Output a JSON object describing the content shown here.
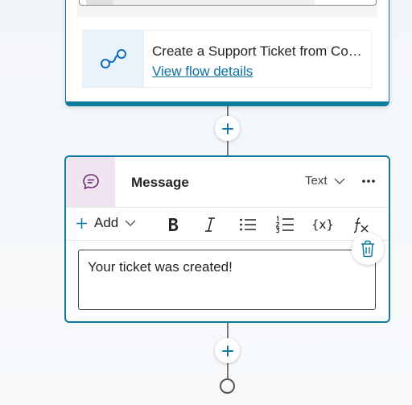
{
  "flow_card": {
    "title": "Create a Support Ticket from Co…",
    "link": "View flow details",
    "icon": "flow-connector-icon"
  },
  "message_card": {
    "icon": "chat-bubble-icon",
    "title": "Message",
    "type_dropdown": "Text",
    "more_icon": "ellipsis-icon",
    "toolbar": {
      "add_label": "Add",
      "bold_icon": "bold-icon",
      "italic_icon": "italic-icon",
      "bullet_icon": "bullet-list-icon",
      "numbered_icon": "numbered-list-icon",
      "variable_label": "{x}",
      "formula_icon": "formula-icon"
    },
    "message_text": "Your ticket was created!"
  },
  "delete_icon": "trash-icon",
  "add_node_icon": "plus-icon",
  "colors": {
    "accent": "#0e7a9c",
    "link": "#0e6fa0",
    "flow_icon_bg": "#e8f3fc",
    "message_icon_bg": "#efe4ef"
  }
}
